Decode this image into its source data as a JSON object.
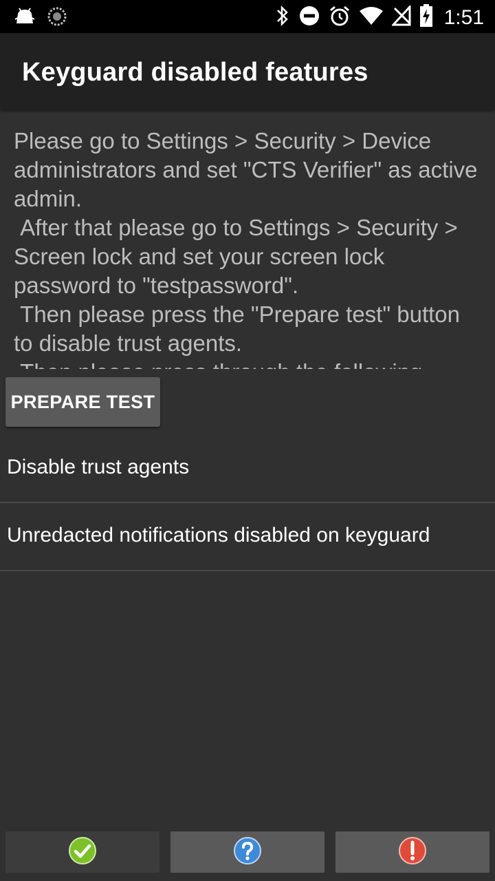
{
  "status_bar": {
    "time": "1:51",
    "icons": [
      "android-debug-icon",
      "sync-icon",
      "bluetooth-icon",
      "do-not-disturb-icon",
      "alarm-icon",
      "wifi-icon",
      "no-signal-icon",
      "battery-charging-icon"
    ]
  },
  "app_bar": {
    "title": "Keyguard disabled features"
  },
  "instructions": {
    "text": "Please go to Settings > Security > Device administrators and set \"CTS Verifier\" as active admin.\n After that please go to Settings > Security > Screen lock and set your screen lock password to \"testpassword\".\n Then please press the \"Prepare test\" button to disable trust agents.\n Then please press through the following"
  },
  "prepare_button": {
    "label": "PREPARE TEST"
  },
  "tests": [
    {
      "label": "Disable trust agents"
    },
    {
      "label": "Unredacted notifications disabled on keyguard"
    }
  ],
  "bottom_buttons": {
    "pass": {
      "icon": "check-icon",
      "color": "#7cc12a"
    },
    "info": {
      "icon": "question-icon",
      "color": "#3f8ad8"
    },
    "fail": {
      "icon": "exclamation-icon",
      "color": "#e04a3a"
    }
  },
  "colors": {
    "background": "#303030",
    "app_bar": "#212121",
    "instruction_text": "#bdbdbd",
    "button": "#5a5a5a"
  }
}
